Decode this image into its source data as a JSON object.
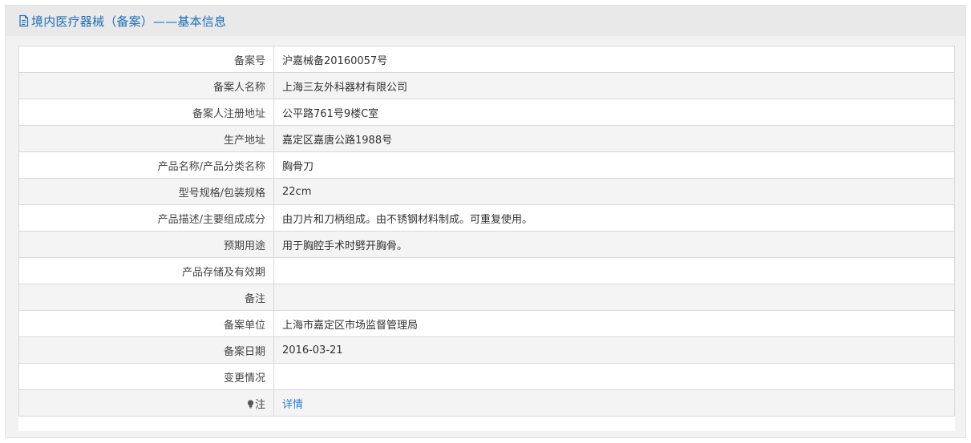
{
  "header": {
    "title": "境内医疗器械（备案）——基本信息",
    "icon": "document-icon"
  },
  "colors": {
    "title": "#1f6fb5",
    "link": "#2f7fd1",
    "header_bg": "#e9e9e9",
    "stripe_bg": "#f4f4f4",
    "border": "#d9d9d9"
  },
  "rows": [
    {
      "label": "备案号",
      "value": "沪嘉械备20160057号"
    },
    {
      "label": "备案人名称",
      "value": "上海三友外科器材有限公司"
    },
    {
      "label": "备案人注册地址",
      "value": "公平路761号9楼C室"
    },
    {
      "label": "生产地址",
      "value": "嘉定区嘉唐公路1988号"
    },
    {
      "label": "产品名称/产品分类名称",
      "value": "胸骨刀"
    },
    {
      "label": "型号规格/包装规格",
      "value": "22cm"
    },
    {
      "label": "产品描述/主要组成成分",
      "value": "由刀片和刀柄组成。由不锈钢材料制成。可重复使用。"
    },
    {
      "label": "预期用途",
      "value": "用于胸腔手术时劈开胸骨。"
    },
    {
      "label": "产品存储及有效期",
      "value": ""
    },
    {
      "label": "备注",
      "value": ""
    },
    {
      "label": "备案单位",
      "value": "上海市嘉定区市场监督管理局"
    },
    {
      "label": "备案日期",
      "value": "2016-03-21"
    },
    {
      "label": "变更情况",
      "value": ""
    }
  ],
  "note_row": {
    "icon": "lightbulb-icon",
    "label": "注",
    "link_text": "详情"
  }
}
